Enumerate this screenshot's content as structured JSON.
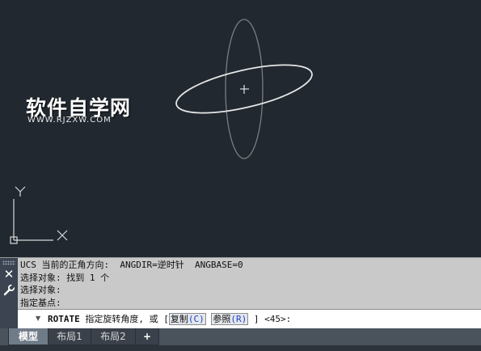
{
  "watermark": {
    "cn": "软件自学网",
    "en": "WWW.RJZXW.COM"
  },
  "ucs": {
    "x_label": "X",
    "y_label": "Y"
  },
  "colors": {
    "viewport_bg": "#212830",
    "panel_bg": "#c9c9c9",
    "option_key": "#1f3fc4",
    "arrow": "#ff2020"
  },
  "command_history": [
    "UCS 当前的正角方向:  ANGDIR=逆时针  ANGBASE=0",
    "选择对象: 找到 1 个",
    "选择对象:",
    "指定基点:"
  ],
  "command_line": {
    "command": "ROTATE",
    "prompt": "指定旋转角度, 或 [",
    "opt1_label": "复制",
    "opt1_key": "(C)",
    "opt2_label": "参照",
    "opt2_key": "(R)",
    "suffix": "] <45>:"
  },
  "tabs": {
    "model": "模型",
    "layout1": "布局1",
    "layout2": "布局2",
    "add": "+"
  }
}
